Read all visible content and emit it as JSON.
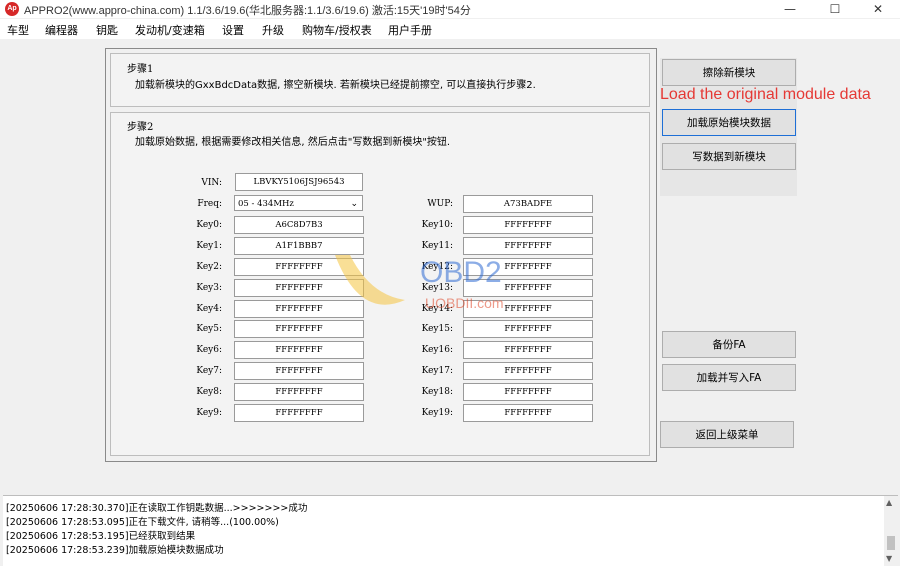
{
  "window": {
    "icon_text": "Ap",
    "title": "APPRO2(www.appro-china.com)  1.1/3.6/19.6(华北服务器:1.1/3.6/19.6)  激活:15天'19时'54分",
    "min_glyph": "—",
    "max_glyph": "☐",
    "close_glyph": "✕"
  },
  "menu": [
    "车型",
    "编程器",
    "钥匙",
    "发动机/变速箱",
    "设置",
    "升级",
    "购物车/授权表",
    "用户手册"
  ],
  "step1": {
    "title": "步骤1",
    "desc": "加载新模块的GxxBdcData数据, 擦空新模块. 若新模块已经提前擦空, 可以直接执行步骤2."
  },
  "step2": {
    "title": "步骤2",
    "desc": "加载原始数据, 根据需要修改相关信息, 然后点击\"写数据到新模块\"按钮."
  },
  "vin": {
    "label": "VIN:",
    "value": "LBVKY5106JSJ96543"
  },
  "freq": {
    "label": "Freq:",
    "value": "05 - 434MHz"
  },
  "wup": {
    "label": "WUP:",
    "value": "A73BADFE"
  },
  "keys_left": [
    {
      "label": "Key0:",
      "value": "A6C8D7B3"
    },
    {
      "label": "Key1:",
      "value": "A1F1BBB7"
    },
    {
      "label": "Key2:",
      "value": "FFFFFFFF"
    },
    {
      "label": "Key3:",
      "value": "FFFFFFFF"
    },
    {
      "label": "Key4:",
      "value": "FFFFFFFF"
    },
    {
      "label": "Key5:",
      "value": "FFFFFFFF"
    },
    {
      "label": "Key6:",
      "value": "FFFFFFFF"
    },
    {
      "label": "Key7:",
      "value": "FFFFFFFF"
    },
    {
      "label": "Key8:",
      "value": "FFFFFFFF"
    },
    {
      "label": "Key9:",
      "value": "FFFFFFFF"
    }
  ],
  "keys_right": [
    {
      "label": "Key10:",
      "value": "FFFFFFFF"
    },
    {
      "label": "Key11:",
      "value": "FFFFFFFF"
    },
    {
      "label": "Key12:",
      "value": "FFFFFFFF"
    },
    {
      "label": "Key13:",
      "value": "FFFFFFFF"
    },
    {
      "label": "Key14:",
      "value": "FFFFFFFF"
    },
    {
      "label": "Key15:",
      "value": "FFFFFFFF"
    },
    {
      "label": "Key16:",
      "value": "FFFFFFFF"
    },
    {
      "label": "Key17:",
      "value": "FFFFFFFF"
    },
    {
      "label": "Key18:",
      "value": "FFFFFFFF"
    },
    {
      "label": "Key19:",
      "value": "FFFFFFFF"
    }
  ],
  "buttons": {
    "erase_new_module": "擦除新模块",
    "load_original_data": "加载原始模块数据",
    "write_to_new_module": "写数据到新模块",
    "backup_fa": "备份FA",
    "load_write_fa": "加载并写入FA",
    "return_menu": "返回上级菜单"
  },
  "annotation": "Load the original module data",
  "watermark": {
    "brand": "OBD2",
    "site": "UOBDII.com"
  },
  "log": [
    "[20250606 17:28:30.370]正在读取工作钥匙数据...>>>>>>>成功",
    "[20250606 17:28:53.095]正在下载文件, 请稍等...(100.00%)",
    "[20250606 17:28:53.195]已经获取到结果",
    "[20250606 17:28:53.239]加载原始模块数据成功"
  ]
}
